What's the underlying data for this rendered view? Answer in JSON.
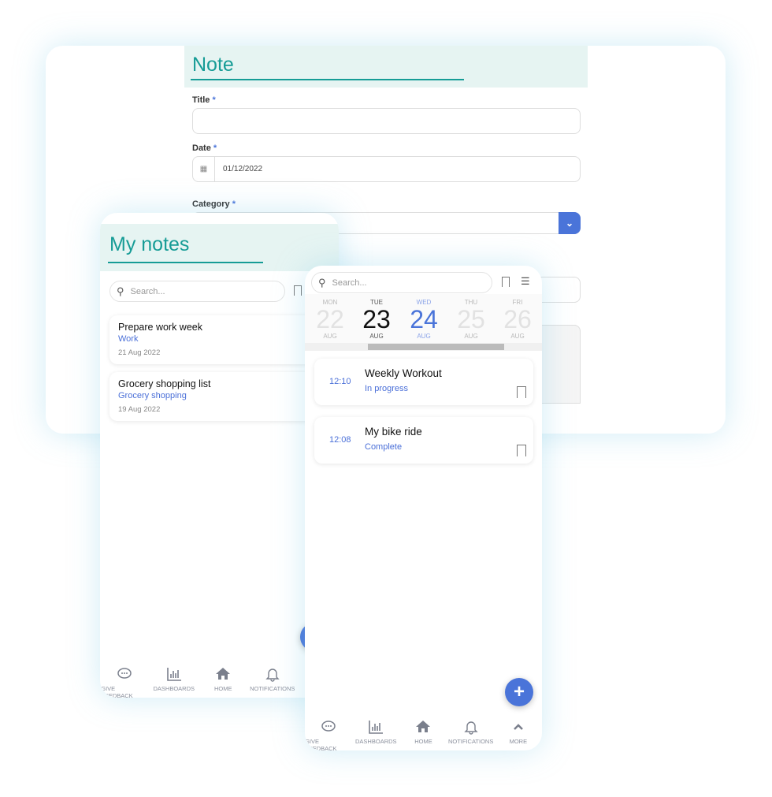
{
  "note_form": {
    "title": "Note",
    "fields": [
      {
        "label": "Title",
        "required": "*",
        "value": ""
      },
      {
        "label": "Date",
        "required": "*",
        "value": "01/12/2022",
        "icon": "calendar-icon"
      },
      {
        "label": "Category",
        "required": "*",
        "value": ""
      }
    ]
  },
  "my_notes": {
    "title": "My notes",
    "search_placeholder": "Search...",
    "notes": [
      {
        "title": "Prepare work week",
        "category": "Work",
        "date": "21 Aug 2022"
      },
      {
        "title": "Grocery shopping list",
        "category": "Grocery shopping",
        "date": "19 Aug 2022"
      }
    ],
    "nav": [
      "GIVE FEEDBACK",
      "DASHBOARDS",
      "HOME",
      "NOTIFICATIONS"
    ]
  },
  "activity": {
    "search_placeholder": "Search...",
    "days": [
      {
        "dow": "MON",
        "num": "22",
        "mon": "AUG"
      },
      {
        "dow": "TUE",
        "num": "23",
        "mon": "AUG"
      },
      {
        "dow": "WED",
        "num": "24",
        "mon": "AUG"
      },
      {
        "dow": "THU",
        "num": "25",
        "mon": "AUG"
      },
      {
        "dow": "FRI",
        "num": "26",
        "mon": "AUG"
      }
    ],
    "items": [
      {
        "time": "12:10",
        "title": "Weekly Workout",
        "status": "In progress"
      },
      {
        "time": "12:08",
        "title": "My bike ride",
        "status": "Complete"
      }
    ],
    "fab": "+",
    "nav": [
      "GIVE FEEDBACK",
      "DASHBOARDS",
      "HOME",
      "NOTIFICATIONS",
      "MORE"
    ]
  },
  "colors": {
    "accent": "#169c96",
    "primary": "#4a74d9",
    "band": "#e6f4f2"
  }
}
